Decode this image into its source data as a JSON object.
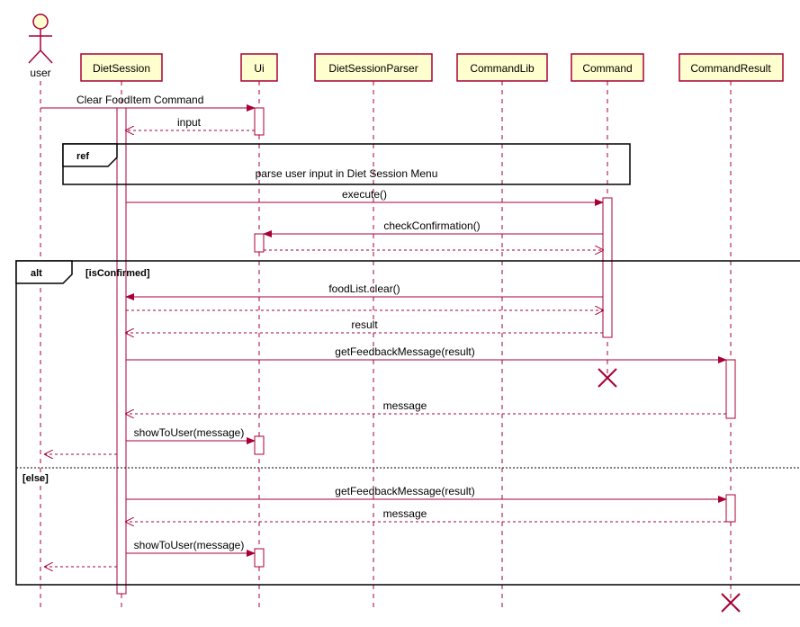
{
  "actor": {
    "name": "user"
  },
  "participants": [
    {
      "name": "DietSession"
    },
    {
      "name": "Ui"
    },
    {
      "name": "DietSessionParser"
    },
    {
      "name": "CommandLib"
    },
    {
      "name": "Command"
    },
    {
      "name": "CommandResult"
    }
  ],
  "messages": {
    "m1": "Clear FoodItem Command",
    "m2": "input",
    "ref": "parse user input in Diet Session Menu",
    "m3": "execute()",
    "m4": "checkConfirmation()",
    "m5": "foodList.clear()",
    "m6": "result",
    "m7": "getFeedbackMessage(result)",
    "m8": "message",
    "m9": "showToUser(message)",
    "m10": "getFeedbackMessage(result)",
    "m11": "message",
    "m12": "showToUser(message)"
  },
  "frames": {
    "refLabel": "ref",
    "altLabel": "alt",
    "altGuard1": "[isConfirmed]",
    "altGuard2": "[else]"
  }
}
